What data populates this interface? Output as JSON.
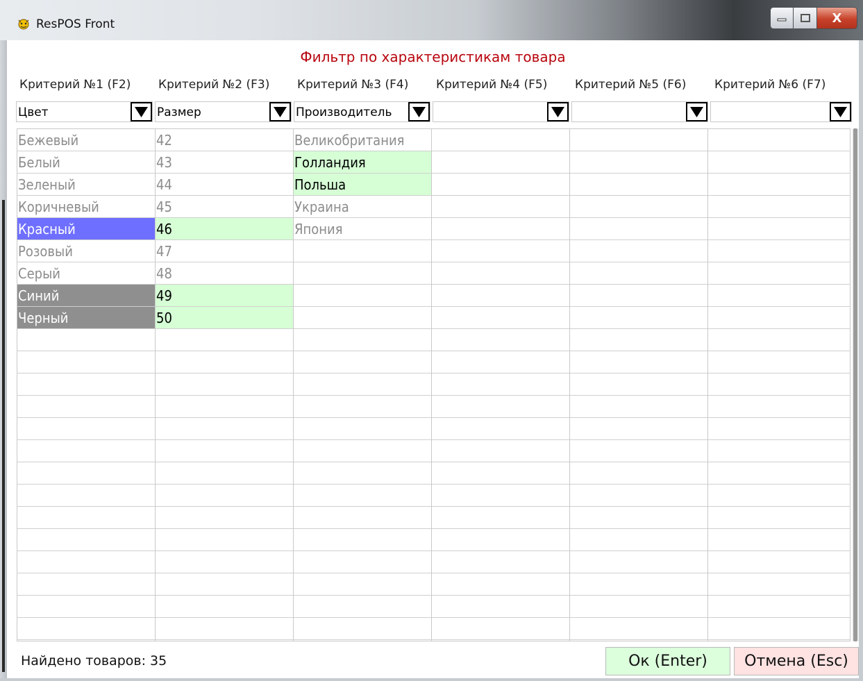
{
  "window": {
    "title": "ResPOS Front",
    "close_symbol": "X"
  },
  "heading": "Фильтр по характеристикам товара",
  "criteria": [
    {
      "label": "Критерий №1 (F2)",
      "value": "Цвет"
    },
    {
      "label": "Критерий №2 (F3)",
      "value": "Размер"
    },
    {
      "label": "Критерий №3 (F4)",
      "value": "Производитель"
    },
    {
      "label": "Критерий №4 (F5)",
      "value": ""
    },
    {
      "label": "Критерий №5 (F6)",
      "value": ""
    },
    {
      "label": "Критерий №6 (F7)",
      "value": ""
    }
  ],
  "columns": [
    [
      {
        "text": "Бежевый",
        "state": "inactive"
      },
      {
        "text": "Белый",
        "state": "inactive"
      },
      {
        "text": "Зеленый",
        "state": "inactive"
      },
      {
        "text": "Коричневый",
        "state": "inactive"
      },
      {
        "text": "Красный",
        "state": "selected"
      },
      {
        "text": "Розовый",
        "state": "inactive"
      },
      {
        "text": "Серый",
        "state": "inactive"
      },
      {
        "text": "Синий",
        "state": "dim"
      },
      {
        "text": "Черный",
        "state": "dim"
      }
    ],
    [
      {
        "text": "42",
        "state": "inactive"
      },
      {
        "text": "43",
        "state": "inactive"
      },
      {
        "text": "44",
        "state": "inactive"
      },
      {
        "text": "45",
        "state": "inactive"
      },
      {
        "text": "46",
        "state": "avail"
      },
      {
        "text": "47",
        "state": "inactive"
      },
      {
        "text": "48",
        "state": "inactive"
      },
      {
        "text": "49",
        "state": "avail"
      },
      {
        "text": "50",
        "state": "avail"
      }
    ],
    [
      {
        "text": "Великобритания",
        "state": "inactive"
      },
      {
        "text": "Голландия",
        "state": "avail"
      },
      {
        "text": "Польша",
        "state": "avail"
      },
      {
        "text": "Украина",
        "state": "inactive"
      },
      {
        "text": "Япония",
        "state": "inactive"
      }
    ],
    [],
    [],
    []
  ],
  "footer": {
    "found_text": "Найдено товаров: 35",
    "ok_label": "Ок (Enter)",
    "cancel_label": "Отмена (Esc)"
  },
  "colors": {
    "heading": "#b8070f",
    "available_bg": "#d6ffd6",
    "selected_bg": "#6f6fff",
    "dimmed_bg": "#8f8f8f",
    "inactive_text": "#8c8c8c",
    "ok_bg": "#dcffdc",
    "cancel_bg": "#ffe2e2"
  }
}
